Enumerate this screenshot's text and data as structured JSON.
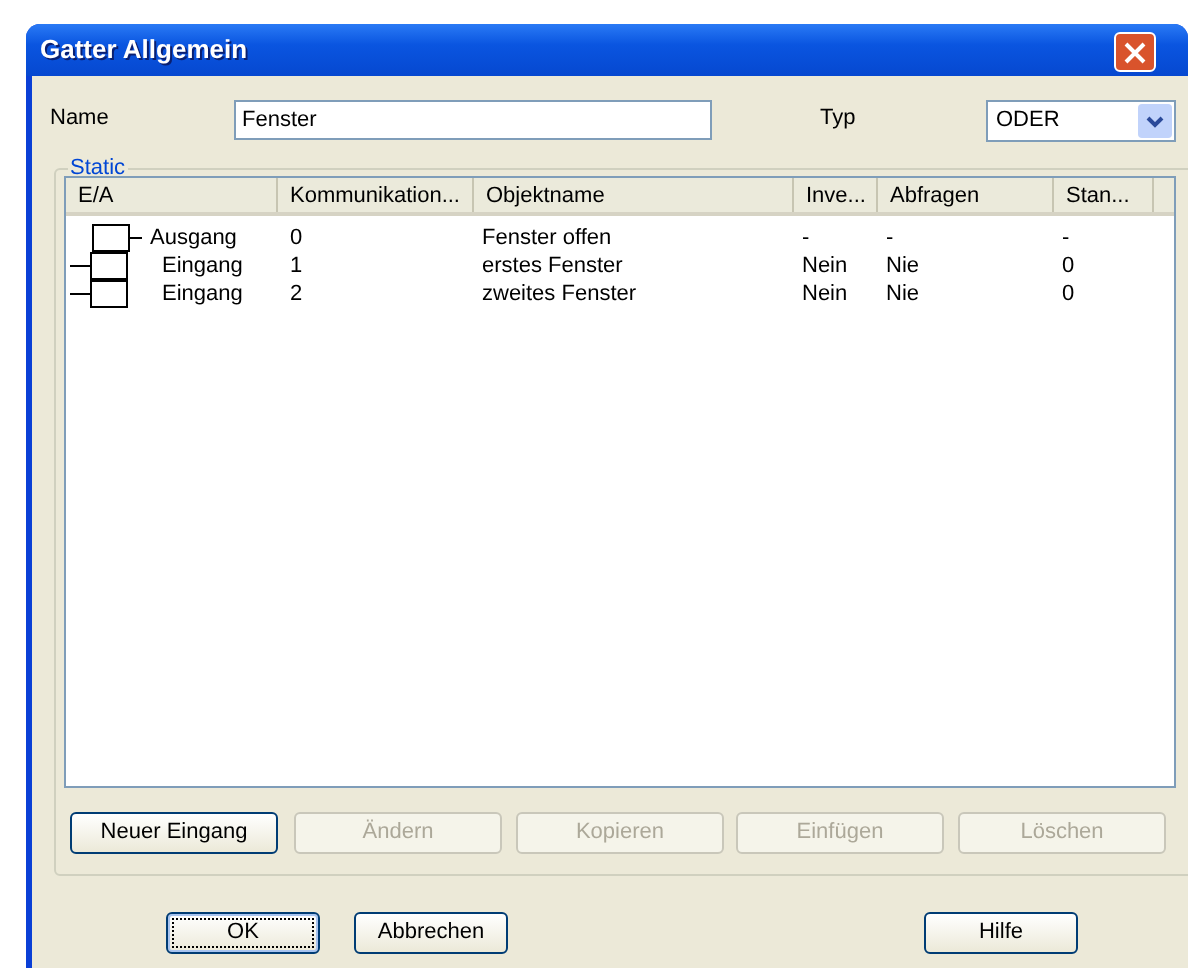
{
  "window": {
    "title": "Gatter Allgemein"
  },
  "name_field": {
    "label": "Name",
    "value": "Fenster"
  },
  "type_field": {
    "label": "Typ",
    "value": "ODER"
  },
  "group": {
    "title": "Static"
  },
  "table": {
    "columns": [
      "E/A",
      "Kommunikation...",
      "Objektname",
      "Inve...",
      "Abfragen",
      "Stan..."
    ],
    "rows": [
      {
        "kind": "output",
        "cells": [
          "Ausgang",
          "0",
          "Fenster offen",
          "-",
          "-",
          "-"
        ]
      },
      {
        "kind": "input",
        "cells": [
          "Eingang",
          "1",
          "erstes Fenster",
          "Nein",
          "Nie",
          "0"
        ]
      },
      {
        "kind": "input",
        "cells": [
          "Eingang",
          "2",
          "zweites Fenster",
          "Nein",
          "Nie",
          "0"
        ]
      }
    ]
  },
  "list_buttons": [
    {
      "label": "Neuer Eingang",
      "disabled": false
    },
    {
      "label": "Ändern",
      "disabled": true
    },
    {
      "label": "Kopieren",
      "disabled": true
    },
    {
      "label": "Einfügen",
      "disabled": true
    },
    {
      "label": "Löschen",
      "disabled": true
    }
  ],
  "dialog_buttons": [
    {
      "label": "OK",
      "focused": true
    },
    {
      "label": "Abbrechen",
      "focused": false
    },
    {
      "label": "Hilfe",
      "focused": false
    }
  ]
}
